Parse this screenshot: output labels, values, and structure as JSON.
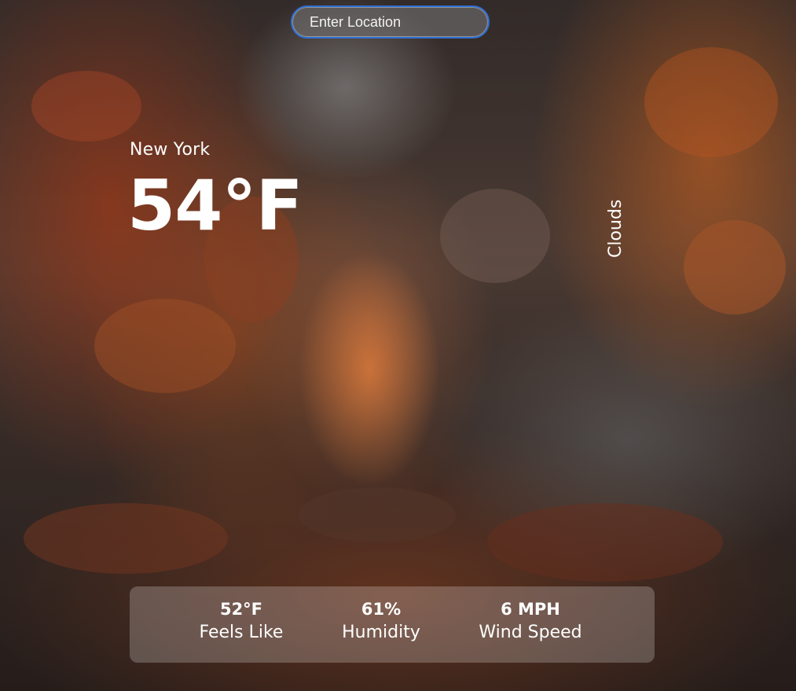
{
  "search": {
    "placeholder": "Enter Location",
    "value": ""
  },
  "weather": {
    "location": "New York",
    "temperature": "54°F",
    "description": "Clouds"
  },
  "stats": {
    "feels_like": {
      "value": "52°F",
      "label": "Feels Like"
    },
    "humidity": {
      "value": "61%",
      "label": "Humidity"
    },
    "wind_speed": {
      "value": "6 MPH",
      "label": "Wind Speed"
    }
  },
  "colors": {
    "search_border": "#2f6fd6",
    "text": "#ffffff",
    "panel": "rgba(255,255,255,0.22)"
  }
}
